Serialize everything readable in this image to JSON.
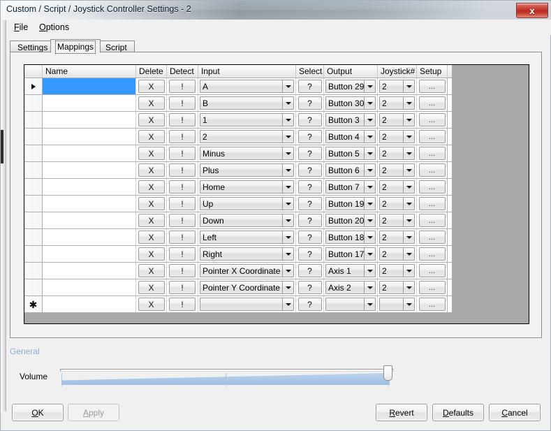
{
  "window": {
    "title": "Custom / Script / Joystick Controller Settings - 2",
    "close_label": "x",
    "close_icon": "close-icon"
  },
  "menubar": {
    "items": [
      {
        "label": "File",
        "accel": "F"
      },
      {
        "label": "Options",
        "accel": "O"
      }
    ]
  },
  "tabs": [
    {
      "label": "Settings",
      "active": false
    },
    {
      "label": "Mappings",
      "active": true
    },
    {
      "label": "Script",
      "active": false
    }
  ],
  "grid": {
    "columns": [
      {
        "key": "selector",
        "label": ""
      },
      {
        "key": "name",
        "label": "Name"
      },
      {
        "key": "delete",
        "label": "Delete"
      },
      {
        "key": "detect",
        "label": "Detect"
      },
      {
        "key": "input",
        "label": "Input"
      },
      {
        "key": "select",
        "label": "Select"
      },
      {
        "key": "output",
        "label": "Output"
      },
      {
        "key": "joystick",
        "label": "Joystick#"
      },
      {
        "key": "setup",
        "label": "Setup"
      }
    ],
    "button_labels": {
      "delete": "X",
      "detect": "!",
      "select": "?",
      "setup": "..."
    },
    "selected_row_color": "#3399ff",
    "rows": [
      {
        "indicator": "current",
        "name": "",
        "name_selected": true,
        "input": "A",
        "output": "Button 29",
        "joystick": "2"
      },
      {
        "indicator": "",
        "name": "",
        "name_selected": false,
        "input": "B",
        "output": "Button 30",
        "joystick": "2"
      },
      {
        "indicator": "",
        "name": "",
        "name_selected": false,
        "input": "1",
        "output": "Button 3",
        "joystick": "2"
      },
      {
        "indicator": "",
        "name": "",
        "name_selected": false,
        "input": "2",
        "output": "Button 4",
        "joystick": "2"
      },
      {
        "indicator": "",
        "name": "",
        "name_selected": false,
        "input": "Minus",
        "output": "Button 5",
        "joystick": "2"
      },
      {
        "indicator": "",
        "name": "",
        "name_selected": false,
        "input": "Plus",
        "output": "Button 6",
        "joystick": "2"
      },
      {
        "indicator": "",
        "name": "",
        "name_selected": false,
        "input": "Home",
        "output": "Button 7",
        "joystick": "2"
      },
      {
        "indicator": "",
        "name": "",
        "name_selected": false,
        "input": "Up",
        "output": "Button 19",
        "joystick": "2"
      },
      {
        "indicator": "",
        "name": "",
        "name_selected": false,
        "input": "Down",
        "output": "Button 20",
        "joystick": "2"
      },
      {
        "indicator": "",
        "name": "",
        "name_selected": false,
        "input": "Left",
        "output": "Button 18",
        "joystick": "2"
      },
      {
        "indicator": "",
        "name": "",
        "name_selected": false,
        "input": "Right",
        "output": "Button 17",
        "joystick": "2"
      },
      {
        "indicator": "",
        "name": "",
        "name_selected": false,
        "input": "Pointer X Coordinate",
        "output": "Axis 1",
        "joystick": "2"
      },
      {
        "indicator": "",
        "name": "",
        "name_selected": false,
        "input": "Pointer Y Coordinate",
        "output": "Axis 2",
        "joystick": "2"
      },
      {
        "indicator": "new",
        "name": "",
        "name_selected": false,
        "input": "",
        "output": "",
        "joystick": ""
      }
    ]
  },
  "general": {
    "group_label": "General",
    "volume_label": "Volume",
    "volume_value": 100
  },
  "footer": {
    "buttons": [
      {
        "id": "ok",
        "label": "OK",
        "accel": "O",
        "disabled": false
      },
      {
        "id": "apply",
        "label": "Apply",
        "accel": "A",
        "disabled": true
      },
      {
        "id": "revert",
        "label": "Revert",
        "accel": "R",
        "disabled": false
      },
      {
        "id": "defaults",
        "label": "Defaults",
        "accel": "D",
        "disabled": false
      },
      {
        "id": "cancel",
        "label": "Cancel",
        "accel": "C",
        "disabled": false
      }
    ]
  }
}
